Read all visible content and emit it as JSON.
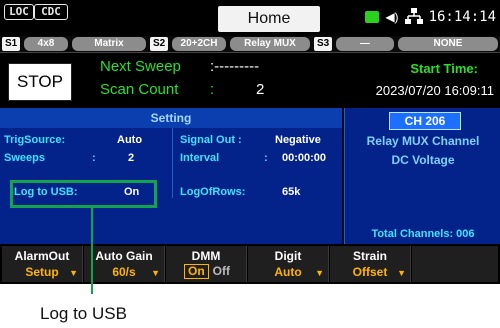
{
  "status": {
    "loc": "LOC",
    "cdc": "CDC",
    "home_tab": "Home",
    "time": "16:14:14"
  },
  "tabs": [
    {
      "slot": "S1",
      "label": "4x8"
    },
    {
      "label": "Matrix"
    },
    {
      "slot": "S2",
      "label": "20+2CH"
    },
    {
      "label": "Relay MUX"
    },
    {
      "slot": "S3",
      "label": "—"
    },
    {
      "label": "NONE"
    }
  ],
  "info": {
    "stop_button": "STOP",
    "next_sweep_label": "Next Sweep",
    "next_sweep_value": ":---------",
    "scan_count_label": "Scan Count",
    "scan_count_sep": ":",
    "scan_count_value": "2",
    "start_time_label": "Start Time:",
    "start_time_value": "2023/07/20 16:09:11"
  },
  "setting": {
    "header": "Setting",
    "rows": [
      {
        "label": "TrigSource:",
        "value": "Auto",
        "label2": "Signal Out :",
        "value2": "Negative"
      },
      {
        "label": "Sweeps",
        "sep": ":",
        "value": "2",
        "label2": "Interval",
        "sep2": ":",
        "value2": "00:00:00"
      },
      {
        "label": "Log to USB:",
        "value": "On",
        "label2": "LogOfRows:",
        "value2": "65k"
      }
    ]
  },
  "channel": {
    "badge": "CH 206",
    "line1": "Relay MUX Channel",
    "line2": "DC Voltage",
    "total": "Total Channels: 006"
  },
  "softkeys": [
    {
      "title": "AlarmOut",
      "value": "Setup"
    },
    {
      "title": "Auto Gain",
      "value": "60/s"
    },
    {
      "title": "DMM",
      "on": "On",
      "off": "Off"
    },
    {
      "title": "Digit",
      "value": "Auto"
    },
    {
      "title": "Strain",
      "value": "Offset"
    }
  ],
  "callout": "Log to USB",
  "colors": {
    "highlight": "#14a24a",
    "accent_green": "#27e02a",
    "softkey_value": "#ffb400",
    "panel_blue": "#04238a"
  }
}
